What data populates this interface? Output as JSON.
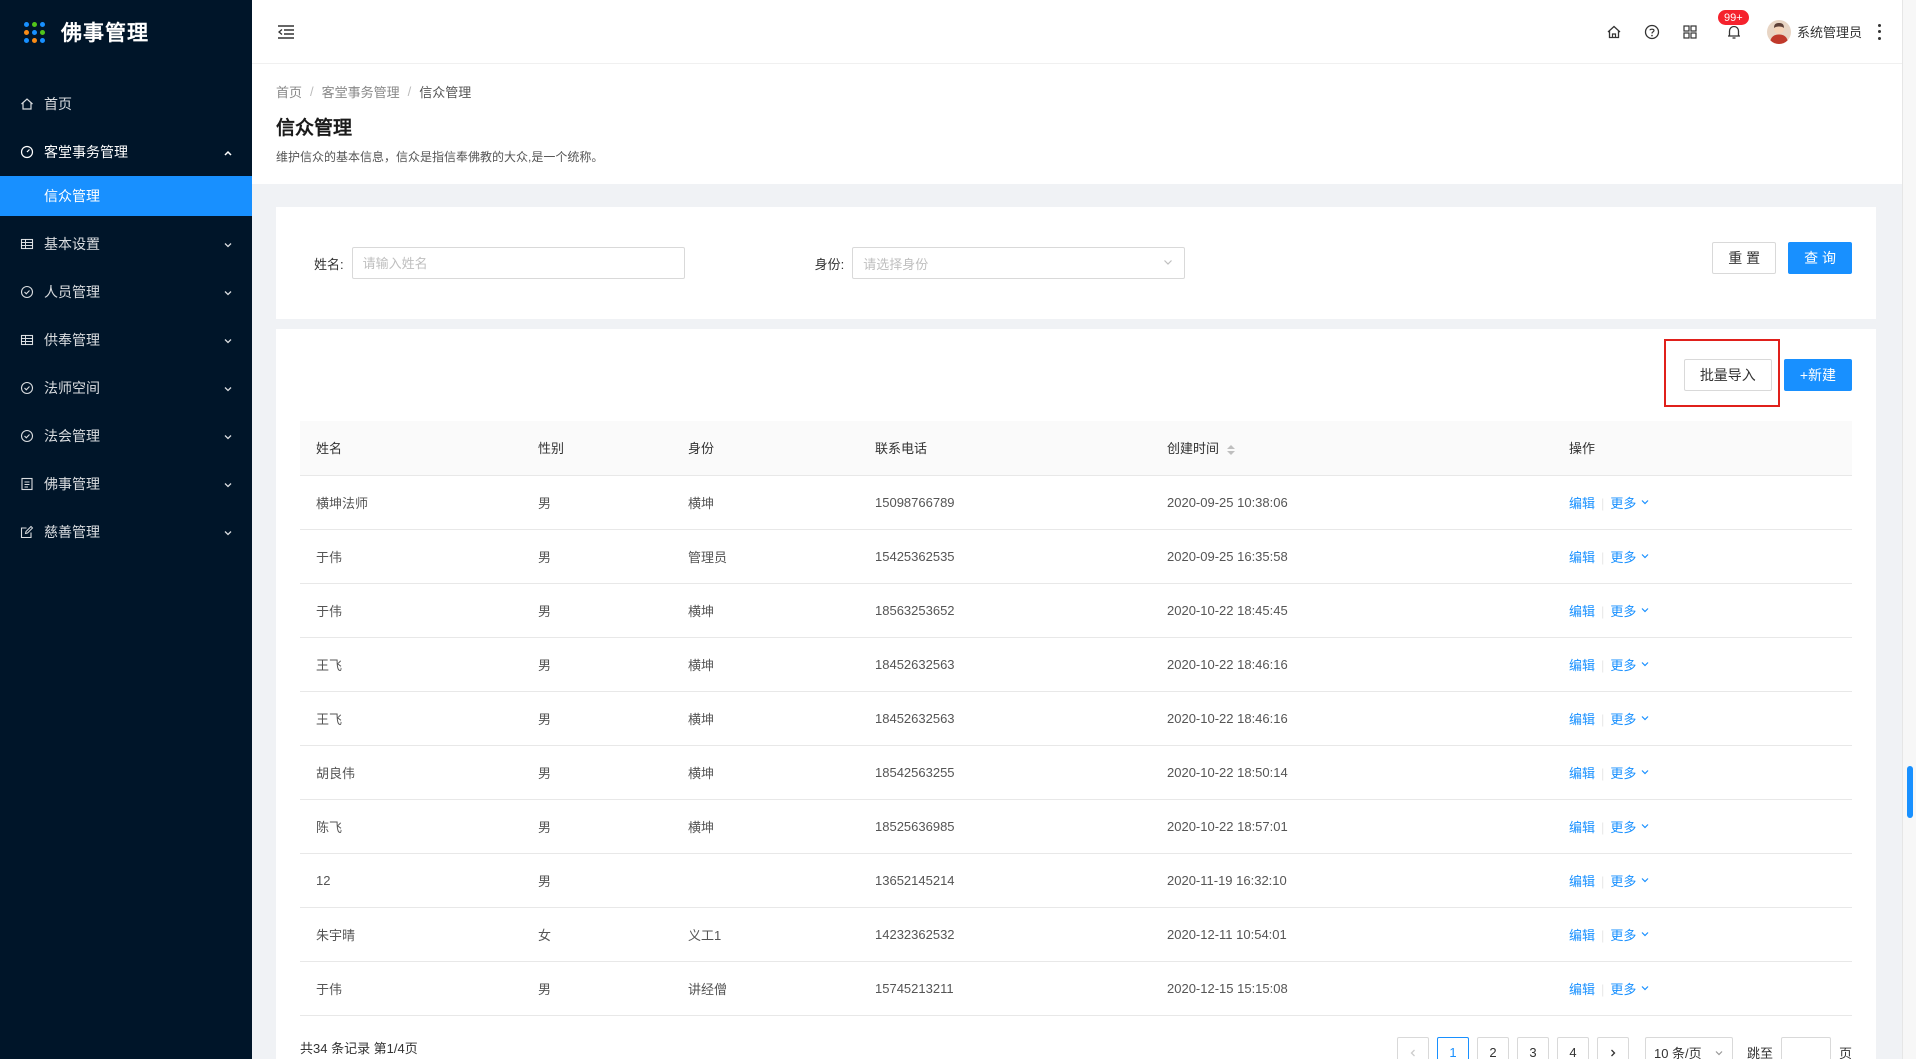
{
  "app": {
    "title": "佛事管理"
  },
  "sidebar": {
    "items": [
      {
        "label": "首页",
        "icon": "home-icon",
        "expandable": false
      },
      {
        "label": "客堂事务管理",
        "icon": "dashboard-icon",
        "expandable": true,
        "open": true,
        "children": [
          {
            "label": "信众管理",
            "active": true
          }
        ]
      },
      {
        "label": "基本设置",
        "icon": "table-icon",
        "expandable": true
      },
      {
        "label": "人员管理",
        "icon": "check-circle-icon",
        "expandable": true
      },
      {
        "label": "供奉管理",
        "icon": "table-icon",
        "expandable": true
      },
      {
        "label": "法师空间",
        "icon": "check-circle-icon",
        "expandable": true
      },
      {
        "label": "法会管理",
        "icon": "check-circle-icon",
        "expandable": true
      },
      {
        "label": "佛事管理",
        "icon": "profile-icon",
        "expandable": true
      },
      {
        "label": "慈善管理",
        "icon": "form-icon",
        "expandable": true
      }
    ]
  },
  "header": {
    "notification_badge": "99+",
    "user_name": "系统管理员"
  },
  "breadcrumb": [
    "首页",
    "客堂事务管理",
    "信众管理"
  ],
  "page": {
    "title": "信众管理",
    "description": "维护信众的基本信息，信众是指信奉佛教的大众,是一个统称。"
  },
  "search": {
    "name_label": "姓名:",
    "name_placeholder": "请输入姓名",
    "identity_label": "身份:",
    "identity_placeholder": "请选择身份",
    "reset_label": "重 置",
    "query_label": "查 询"
  },
  "toolbar": {
    "import_label": "批量导入",
    "new_label": "+新建"
  },
  "table": {
    "columns": [
      "姓名",
      "性别",
      "身份",
      "联系电话",
      "创建时间",
      "操作"
    ],
    "rows": [
      {
        "name": "横坤法师",
        "gender": "男",
        "identity": "横坤",
        "phone": "15098766789",
        "created": "2020-09-25 10:38:06"
      },
      {
        "name": "于伟",
        "gender": "男",
        "identity": "管理员",
        "phone": "15425362535",
        "created": "2020-09-25 16:35:58"
      },
      {
        "name": "于伟",
        "gender": "男",
        "identity": "横坤",
        "phone": "18563253652",
        "created": "2020-10-22 18:45:45"
      },
      {
        "name": "王飞",
        "gender": "男",
        "identity": "横坤",
        "phone": "18452632563",
        "created": "2020-10-22 18:46:16"
      },
      {
        "name": "王飞",
        "gender": "男",
        "identity": "横坤",
        "phone": "18452632563",
        "created": "2020-10-22 18:46:16"
      },
      {
        "name": "胡良伟",
        "gender": "男",
        "identity": "横坤",
        "phone": "18542563255",
        "created": "2020-10-22 18:50:14"
      },
      {
        "name": "陈飞",
        "gender": "男",
        "identity": "横坤",
        "phone": "18525636985",
        "created": "2020-10-22 18:57:01"
      },
      {
        "name": "12",
        "gender": "男",
        "identity": "",
        "phone": "13652145214",
        "created": "2020-11-19 16:32:10"
      },
      {
        "name": "朱宇晴",
        "gender": "女",
        "identity": "义工1",
        "phone": "14232362532",
        "created": "2020-12-11 10:54:01"
      },
      {
        "name": "于伟",
        "gender": "男",
        "identity": "讲经僧",
        "phone": "15745213211",
        "created": "2020-12-15 15:15:08"
      }
    ],
    "action_edit": "编辑",
    "action_more": "更多"
  },
  "pagination": {
    "total_text": "共34 条记录 第1/4页",
    "pages": [
      "1",
      "2",
      "3",
      "4"
    ],
    "current": "1",
    "page_size": "10 条/页",
    "jump_label": "跳至",
    "page_unit": "页"
  },
  "colors": {
    "sidebar_bg": "#001529",
    "primary": "#1890ff",
    "highlight": "#e0201b",
    "badge": "#f5222d"
  }
}
